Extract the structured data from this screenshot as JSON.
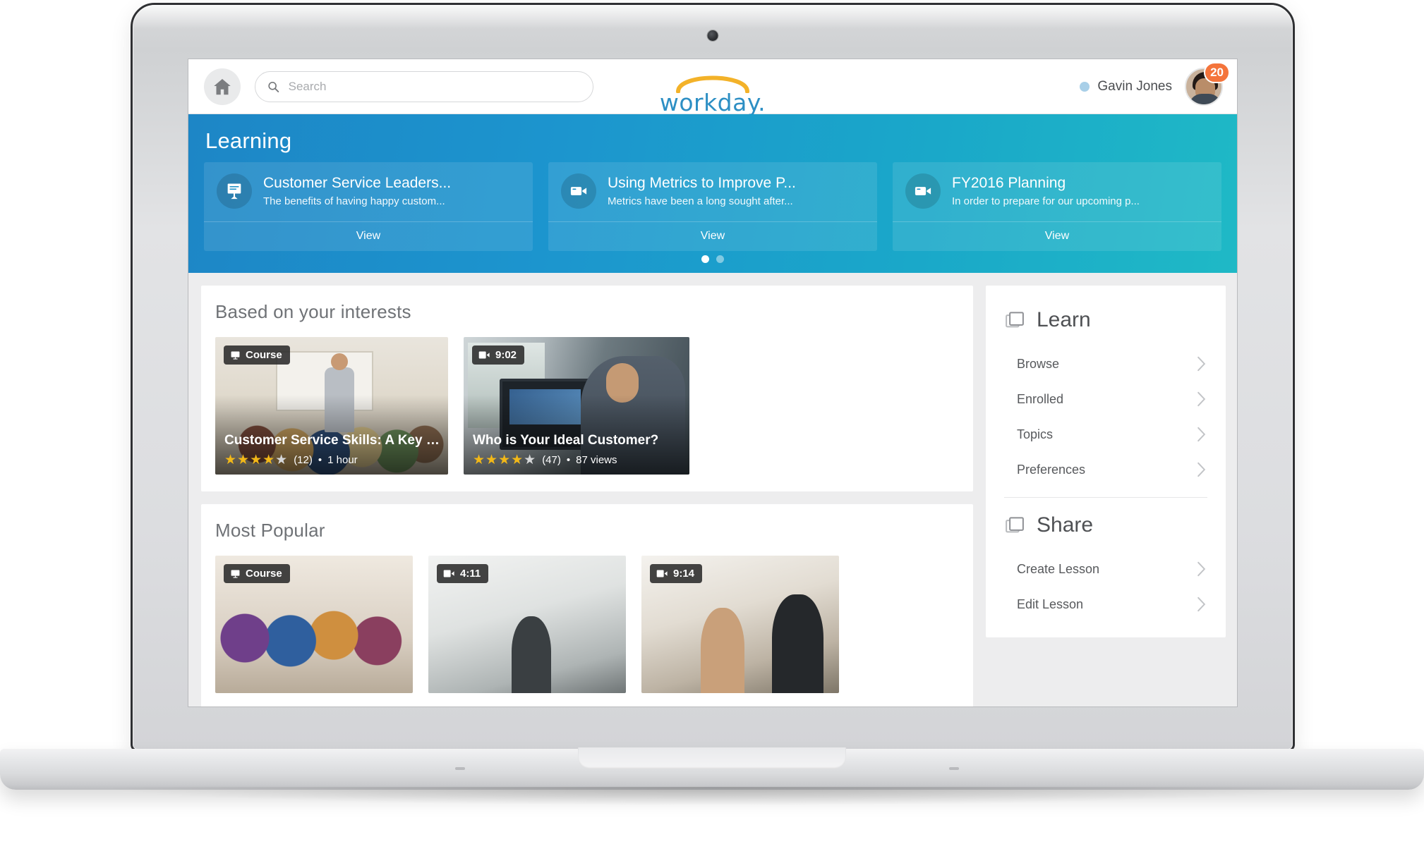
{
  "topbar": {
    "home_icon": "home-icon",
    "search": {
      "value": "",
      "placeholder": "Search",
      "icon": "search-icon"
    },
    "brand": {
      "word": "workday.",
      "arc_color": "#f3b229",
      "word_color": "#2d8fc4"
    },
    "user": {
      "name": "Gavin Jones",
      "status_dot_color": "#a8cfe8",
      "notification_count": "20",
      "badge_color": "#f4743b"
    }
  },
  "hero": {
    "title": "Learning",
    "gradient_from": "#1d86c6",
    "gradient_to": "#1fb9c6",
    "cards": [
      {
        "icon": "presentation-icon",
        "title": "Customer Service Leaders...",
        "subtitle": "The benefits of having happy custom...",
        "action": "View"
      },
      {
        "icon": "video-camera-icon",
        "title": "Using Metrics to Improve P...",
        "subtitle": "Metrics have been a long sought after...",
        "action": "View"
      },
      {
        "icon": "video-camera-icon",
        "title": "FY2016 Planning",
        "subtitle": "In order to prepare for our upcoming p...",
        "action": "View"
      }
    ],
    "carousel": {
      "total": 2,
      "active_index": 0
    }
  },
  "main": {
    "interests": {
      "title": "Based on your interests",
      "tiles": [
        {
          "badge_type": "course",
          "badge_label": "Course",
          "badge_icon": "monitor-icon",
          "name": "Customer Service Skills: A Key to Success",
          "rating_filled": 4,
          "rating_total": 5,
          "rating_count": "(12)",
          "separator": "•",
          "meta": "1 hour"
        },
        {
          "badge_type": "video",
          "badge_label": "9:02",
          "badge_icon": "video-icon",
          "name": "Who is Your Ideal Customer?",
          "rating_filled": 4,
          "rating_total": 5,
          "rating_count": "(47)",
          "separator": "•",
          "meta": "87 views"
        }
      ]
    },
    "most_popular": {
      "title": "Most Popular",
      "tiles": [
        {
          "badge_type": "course",
          "badge_label": "Course",
          "badge_icon": "monitor-icon"
        },
        {
          "badge_type": "video",
          "badge_label": "4:11",
          "badge_icon": "video-icon"
        },
        {
          "badge_type": "video",
          "badge_label": "9:14",
          "badge_icon": "video-icon"
        }
      ]
    }
  },
  "sidebar": {
    "sections": [
      {
        "icon": "stacked-cards-icon",
        "title": "Learn",
        "items": [
          {
            "label": "Browse",
            "chevron": "chevron-right-icon"
          },
          {
            "label": "Enrolled",
            "chevron": "chevron-right-icon"
          },
          {
            "label": "Topics",
            "chevron": "chevron-right-icon"
          },
          {
            "label": "Preferences",
            "chevron": "chevron-right-icon"
          }
        ]
      },
      {
        "icon": "stacked-cards-icon",
        "title": "Share",
        "items": [
          {
            "label": "Create Lesson",
            "chevron": "chevron-right-icon"
          },
          {
            "label": "Edit Lesson",
            "chevron": "chevron-right-icon"
          }
        ]
      }
    ]
  }
}
